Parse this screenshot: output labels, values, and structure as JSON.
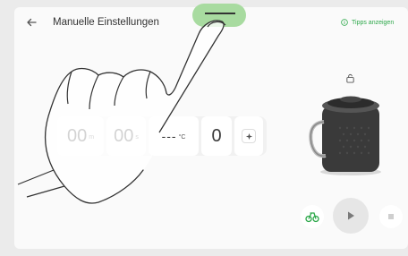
{
  "header": {
    "title": "Manuelle Einstellungen",
    "tips_label": "Tipps anzeigen"
  },
  "settings": {
    "minutes": "00",
    "minutes_unit": "m",
    "seconds": "00",
    "seconds_unit": "s",
    "temperature": "---",
    "temperature_unit": "°C",
    "speed": "0"
  },
  "colors": {
    "accent_green": "#2da84a",
    "toggle_green": "#a8dba0"
  }
}
